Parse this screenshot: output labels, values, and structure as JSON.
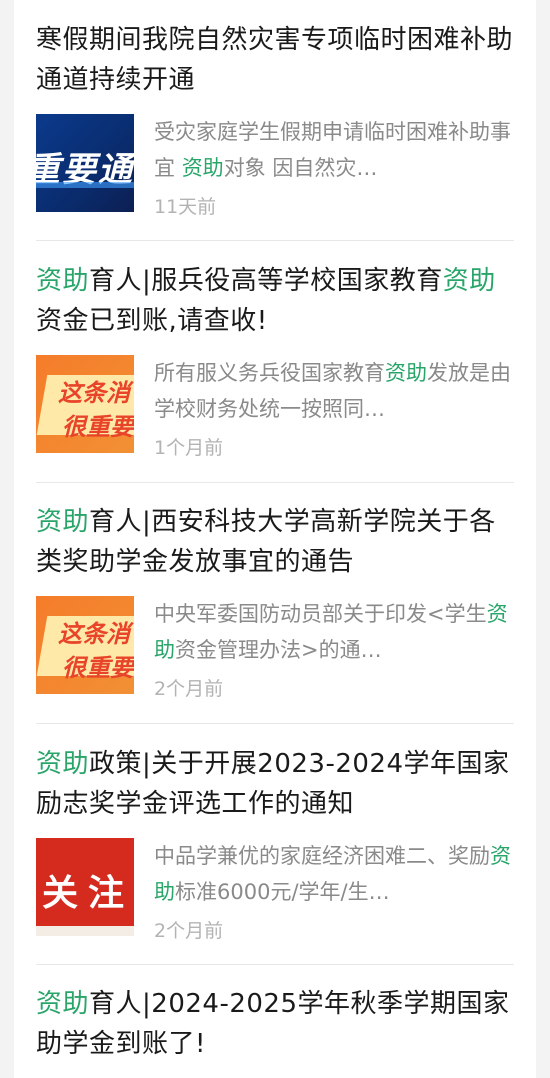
{
  "articles": [
    {
      "title_parts": [
        {
          "text": "寒假期间我院自然灾害专项临时困难补助通道持续开通",
          "hl": false
        }
      ],
      "desc_parts": [
        {
          "text": "受灾家庭学生假期申请临时困难补助事宜 ",
          "hl": false
        },
        {
          "text": "资助",
          "hl": true
        },
        {
          "text": "对象 因自然灾…",
          "hl": false
        }
      ],
      "time": "11天前",
      "thumb_text": "重要通知"
    },
    {
      "title_parts": [
        {
          "text": "资助",
          "hl": true
        },
        {
          "text": "育人|服兵役高等学校国家教育",
          "hl": false
        },
        {
          "text": "资助",
          "hl": true
        },
        {
          "text": "资金已到账,请查收!",
          "hl": false
        }
      ],
      "desc_parts": [
        {
          "text": "所有服义务兵役国家教育",
          "hl": false
        },
        {
          "text": "资助",
          "hl": true
        },
        {
          "text": "发放是由学校财务处统一按照同…",
          "hl": false
        }
      ],
      "time": "1个月前",
      "thumb_text_1": "这条消",
      "thumb_text_2": "很重要"
    },
    {
      "title_parts": [
        {
          "text": "资助",
          "hl": true
        },
        {
          "text": "育人|西安科技大学高新学院关于各类奖助学金发放事宜的通告",
          "hl": false
        }
      ],
      "desc_parts": [
        {
          "text": "中央军委国防动员部关于印发<学生",
          "hl": false
        },
        {
          "text": "资助",
          "hl": true
        },
        {
          "text": "资金管理办法>的通…",
          "hl": false
        }
      ],
      "time": "2个月前",
      "thumb_text_1": "这条消",
      "thumb_text_2": "很重要"
    },
    {
      "title_parts": [
        {
          "text": "资助",
          "hl": true
        },
        {
          "text": "政策|关于开展2023-2024学年国家励志奖学金评选工作的通知",
          "hl": false
        }
      ],
      "desc_parts": [
        {
          "text": "中品学兼优的家庭经济困难二、奖励",
          "hl": false
        },
        {
          "text": "资助",
          "hl": true
        },
        {
          "text": "标准6000元/学年/生…",
          "hl": false
        }
      ],
      "time": "2个月前",
      "thumb_text": "关注"
    },
    {
      "title_parts": [
        {
          "text": "资助",
          "hl": true
        },
        {
          "text": "育人|2024-2025学年秋季学期国家助学金到账了!",
          "hl": false
        }
      ]
    }
  ],
  "colors": {
    "highlight": "#2aa56a",
    "title": "#1a1a1a",
    "desc": "#8a8a8a",
    "time": "#b3b3b3"
  }
}
